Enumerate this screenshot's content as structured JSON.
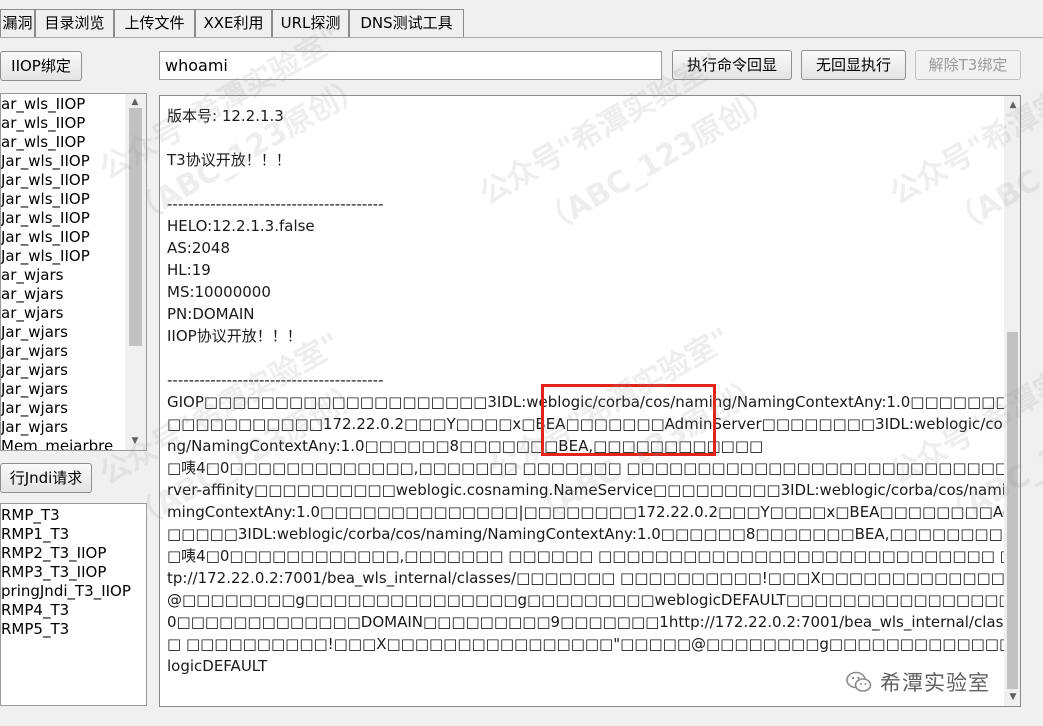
{
  "tabs": [
    {
      "label": "漏洞"
    },
    {
      "label": "目录浏览"
    },
    {
      "label": "上传文件"
    },
    {
      "label": "XXE利用"
    },
    {
      "label": "URL探测"
    },
    {
      "label": "DNS测试工具"
    }
  ],
  "toolbar": {
    "bind_button": "IIOP绑定",
    "command_value": "whoami",
    "exec_echo_button": "执行命令回显",
    "exec_noecho_button": "无回显执行",
    "unbind_t3_button": "解除T3绑定"
  },
  "gadget_list": [
    "ar_wls_IIOP",
    "ar_wls_IIOP",
    "ar_wls_IIOP",
    "Jar_wls_IIOP",
    "Jar_wls_IIOP",
    "Jar_wls_IIOP",
    "Jar_wls_IIOP",
    "Jar_wls_IIOP",
    "Jar_wls_IIOP",
    "ar_wjars",
    "ar_wjars",
    "ar_wjars",
    "Jar_wjars",
    "Jar_wjars",
    "Jar_wjars",
    "Jar_wjars",
    "Jar_wjars",
    "Jar_wjars",
    "Mem_mejarbre"
  ],
  "jndi_button": "行Jndi请求",
  "jndi_list": [
    "RMP_T3",
    "RMP1_T3",
    "RMP2_T3_IIOP",
    "RMP3_T3_IIOP",
    "pringJndi_T3_IIOP",
    "RMP4_T3",
    "RMP5_T3"
  ],
  "output_lines": [
    "版本号: 12.2.1.3",
    "",
    "T3协议开放！！！",
    "",
    "----------------------------------------",
    "HELO:12.2.1.3.false",
    "AS:2048",
    "HL:19",
    "MS:10000000",
    "PN:DOMAIN",
    "IIOP协议开放！！！",
    "",
    "----------------------------------------",
    "GIOP□□□□□□□□□□□□□□□□□□□□3IDL:weblogic/corba/cos/naming/NamingContextAny:1.0□□□□□□□□□□□□□□□□□",
    "□□□□□□□□□□□172.22.0.2□□□Y□□□□x□BEA□□□□□□□AdminServer□□□□□□□□3IDL:weblogic/corba/cos/nami",
    "ng/NamingContextAny:1.0□□□□□□8□□□□□□□BEA,□□□□□□□□□□□□",
    "□咦4□0□□□□□□□□□□□□□,□□□□□□□ □□□□□□□ □□□□□□□□□□□□□□□□□□□□□□□□□□□□□□ □□□□□BEA□□□□□#□□□□□□□□se",
    "rver-affinity□□□□□□□□□□weblogic.cosnaming.NameService□□□□□□□□□3IDL:weblogic/corba/cos/naming/Na",
    "mingContextAny:1.0□□□□□□□□□□□□□□|□□□□□□□□172.22.0.2□□□Y□□□□x□BEA□□□□□□□□AdminServer□□□□",
    "□□□□□3IDL:weblogic/corba/cos/naming/NamingContextAny:1.0□□□□□□8□□□□□□□BEA,□□□□□□□□□□□□□",
    "□咦4□0□□□□□□□□□□□□,□□□□□□□ □□□□□□ □□□□□□□□□□□□□□□□□□□□□□□□□□□□ □□□□□□□□□□9□□□□□□□1ht",
    "tp://172.22.0.2:7001/bea_wls_internal/classes/□□□□□□□ □□□□□□□□□□!□□□X□□□□□□□□□□□□□□□□□\"□□□□□",
    "@□□□□□□□□g□□□□□□□□□□□□□□□g□□□□□□□□□weblogicDEFAULT□□□□□□□□□□□□□□□□□□□□□□□□□□4□",
    "0□□□□□□□□□□□□□DOMAIN□□□□□□□□□9□□□□□□□1http://172.22.0.2:7001/bea_wls_internal/classes/□□□□□□",
    "□ □□□□□□□□□□!□□□X□□□□□□□□□□□□□□□□\"□□□□□@□□□□□□□□g□□□□□□□□□□□□□□□□□g□□□□□□□□□web",
    "logicDEFAULT"
  ],
  "watermarks": [
    "公众号\"希潭实验室\"",
    "（ABC_123原创）",
    "公众号\"希潭实验室\"",
    "（ABC_123原创）",
    "公众号\"希潭实验室\"",
    "（ABC_123原创）",
    "公众号\"希潭实验室\"",
    "（ABC_123原创）",
    "公众号\"希潭实验室\"",
    "（ABC_123原创）",
    "公众号\"希潭实验室\"",
    "（ABC_123原创）"
  ],
  "brand": {
    "text": "希潭实验室",
    "icon": "wechat-icon"
  },
  "colors": {
    "highlight_border": "#e2231a"
  }
}
